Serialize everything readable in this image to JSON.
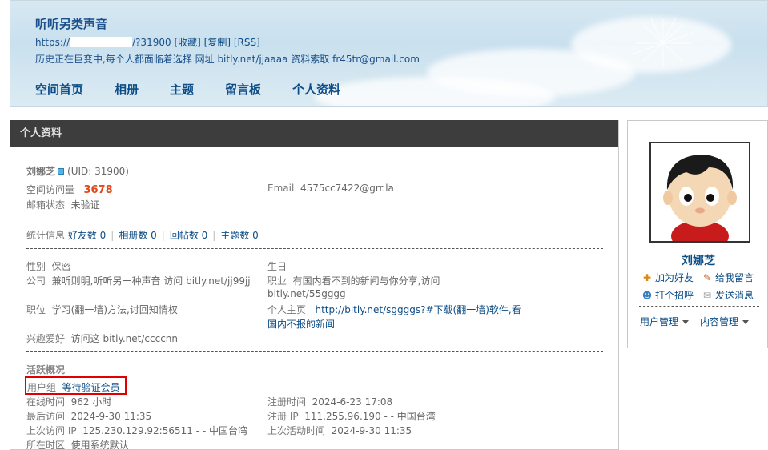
{
  "header": {
    "title": "听听另类声音",
    "url_prefix": "https://",
    "url_suffix": "/?31900",
    "link_fav": "[收藏]",
    "link_copy": "[复制]",
    "link_rss": "[RSS]",
    "description": "历史正在巨变中,每个人都面临着选择 网址 bitly.net/jjaaaa 资料索取 fr45tr@gmail.com"
  },
  "nav": {
    "items": [
      "空间首页",
      "相册",
      "主题",
      "留言板",
      "个人资料"
    ]
  },
  "profile": {
    "panel_title": "个人资料",
    "username": "刘娜芝",
    "uid": "(UID: 31900)",
    "visits_label": "空间访问量",
    "visits_value": "3678",
    "email_label": "Email",
    "email_value": "4575cc7422@grr.la",
    "mail_status_label": "邮箱状态",
    "mail_status_value": "未验证",
    "stats_label": "统计信息",
    "stats": {
      "friends": "好友数 0",
      "albums": "相册数 0",
      "replies": "回帖数 0",
      "threads": "主题数 0"
    },
    "gender_label": "性别",
    "gender_value": "保密",
    "birthday_label": "生日",
    "birthday_value": "-",
    "company_label": "公司",
    "company_value": "兼听则明,听听另一种声音 访问 bitly.net/jj99jj",
    "occupation_label": "职业",
    "occupation_value_1": "有国内看不到的新闻与你分享,访问",
    "occupation_value_2": "bitly.net/55gggg",
    "position_label": "职位",
    "position_value": "学习(翻一墙)方法,讨回知情权",
    "homepage_label": "个人主页",
    "homepage_value_1": "http://bitly.net/sggggs?#下载(翻一墙)软件,看",
    "homepage_value_2": "国内不报的新闻",
    "hobby_label": "兴趣爱好",
    "hobby_value": "访问这 bitly.net/ccccnn"
  },
  "activity": {
    "title": "活跃概况",
    "group_label": "用户组",
    "group_value": "等待验证会员",
    "online_label": "在线时间",
    "online_value": "962 小时",
    "register_label": "注册时间",
    "register_value": "2024-6-23 17:08",
    "last_visit_label": "最后访问",
    "last_visit_value": "2024-9-30 11:35",
    "register_ip_label": "注册 IP",
    "register_ip_value": "111.255.96.190 - - 中国台湾",
    "last_ip_label": "上次访问 IP",
    "last_ip_value": "125.230.129.92:56511 - - 中国台湾",
    "last_active_label": "上次活动时间",
    "last_active_value": "2024-9-30 11:35",
    "timezone_label": "所在时区",
    "timezone_value": "使用系统默认"
  },
  "sidebar": {
    "name": "刘娜芝",
    "add_friend": "加为好友",
    "leave_message": "给我留言",
    "poke": "打个招呼",
    "send_message": "发送消息",
    "user_manage": "用户管理",
    "content_manage": "内容管理"
  },
  "colors": {
    "link": "#0d4d86",
    "panel_header_bg": "#3d3d3d",
    "visits_highlight": "#e04a1a",
    "highlight_box": "#e00000"
  }
}
